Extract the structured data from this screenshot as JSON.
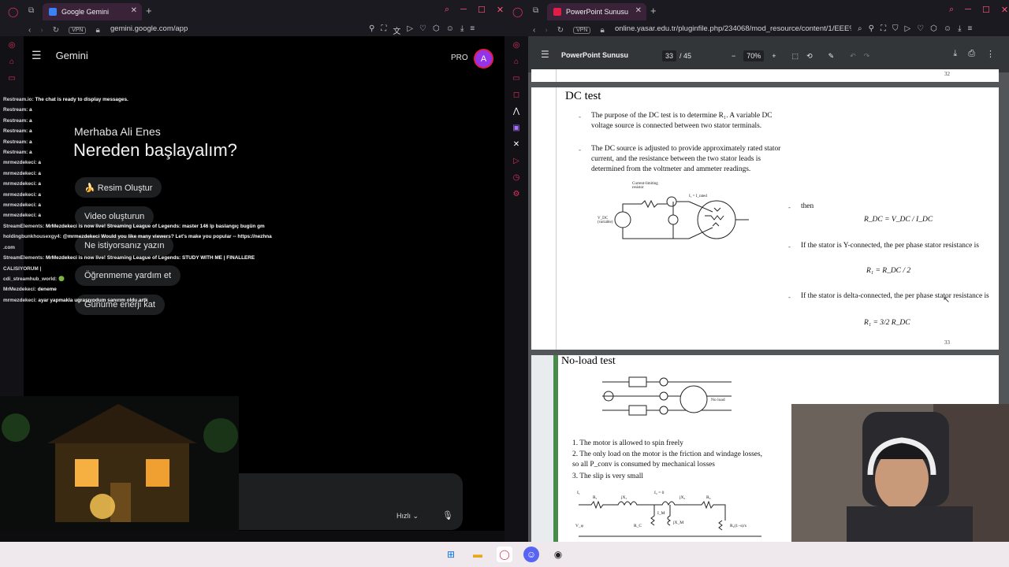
{
  "left_window": {
    "tab_title": "Google Gemini",
    "url": "gemini.google.com/app",
    "vpn": "VPN",
    "app_title": "Gemini",
    "pro_label": "PRO",
    "avatar_letter": "A",
    "greeting": "Merhaba Ali Enes",
    "headline": "Nereden başlayalım?",
    "chips": [
      "🍌 Resim Oluştur",
      "Video oluşturun",
      "Ne istiyorsanız yazın",
      "Öğrenmeme yardım et",
      "Günüme enerji kat"
    ],
    "model_speed": "Hızlı",
    "chat_overlay": [
      {
        "user": "Restream.io:",
        "msg": "The chat is ready to display messages."
      },
      {
        "user": "Restream:",
        "msg": "a"
      },
      {
        "user": "Restream:",
        "msg": "a"
      },
      {
        "user": "Restream:",
        "msg": "a"
      },
      {
        "user": "Restream:",
        "msg": "a"
      },
      {
        "user": "Restream:",
        "msg": "a"
      },
      {
        "user": "mrmezdekeci:",
        "msg": "a"
      },
      {
        "user": "mrmezdekeci:",
        "msg": "a"
      },
      {
        "user": "mrmezdekeci:",
        "msg": "a"
      },
      {
        "user": "mrmezdekeci:",
        "msg": "a"
      },
      {
        "user": "mrmezdekeci:",
        "msg": "a"
      },
      {
        "user": "mrmezdekeci:",
        "msg": "a"
      },
      {
        "user": "StreamElements:",
        "msg": "MrMezdekeci is now live! Streaming League of Legends: master 146 lp baslangıç bugün gm"
      },
      {
        "user": "holdingbunkhousexgy4:",
        "msg": "@mrmezdekeci Would you like many viewers? Let's make you popular -- https://nezhna"
      },
      {
        "user": ".com",
        "msg": ""
      },
      {
        "user": "StreamElements:",
        "msg": "MrMezdekeci is now live! Streaming League of Legends: STUDY WITH ME | FINALLERE"
      },
      {
        "user": "CALISIYORUM |",
        "msg": ""
      },
      {
        "user": "cdi_streamhub_world:",
        "msg": "🟢"
      },
      {
        "user": "MrMezdekeci:",
        "msg": "deneme"
      },
      {
        "user": "mrmezdekeci:",
        "msg": "ayar yapmakla ugrasıyodum sanırım oldu artk"
      }
    ]
  },
  "right_window": {
    "tab_title": "PowerPoint Sunusu",
    "url": "online.yasar.edu.tr/pluginfile.php/234068/mod_resource/content/1/EEE%:",
    "vpn": "VPN",
    "pdf_title": "PowerPoint Sunusu",
    "current_page": "33",
    "total_pages": "/ 45",
    "zoom": "70%",
    "prev_page_number": "32",
    "slide33": {
      "title": "DC test",
      "bullets": [
        "The purpose of the DC test is to determine R₁. A variable DC voltage source is connected between two stator terminals.",
        "The DC source is adjusted to provide approximately rated stator current, and the resistance between the two stator leads is determined from the voltmeter and ammeter readings."
      ],
      "diagram_labels": [
        "Current-limiting resistor",
        "I₁ = I_rated",
        "V_DC (variable)"
      ],
      "right_items": [
        {
          "text": "then",
          "formula": "R_DC = V_DC / I_DC"
        },
        {
          "text": "If the stator is Y-connected, the per phase stator resistance is",
          "formula": "R₁ = R_DC / 2"
        },
        {
          "text": "If the stator is delta-connected, the per phase stator resistance is",
          "formula": "R₁ = 3/2 R_DC"
        }
      ],
      "page_number": "33"
    },
    "slide34": {
      "title": "No-load test",
      "diagram_label": "No load",
      "items": [
        "The motor is allowed to spin freely",
        "The only load on the motor is the friction and windage losses, so all P_conv is consumed by mechanical losses",
        "The slip is very small"
      ],
      "circuit_labels": [
        "I₁",
        "R₁",
        "jX₁",
        "I₂ = 0",
        "jX₂",
        "R₂",
        "I_M",
        "R_C",
        "jX_M",
        "V_φ",
        "R₂(1−s)/s"
      ]
    }
  },
  "colors": {
    "accent_red": "#e11d48",
    "gemini_bg": "#000000",
    "pdf_toolbar": "#323639",
    "avatar": "#9333ea"
  }
}
